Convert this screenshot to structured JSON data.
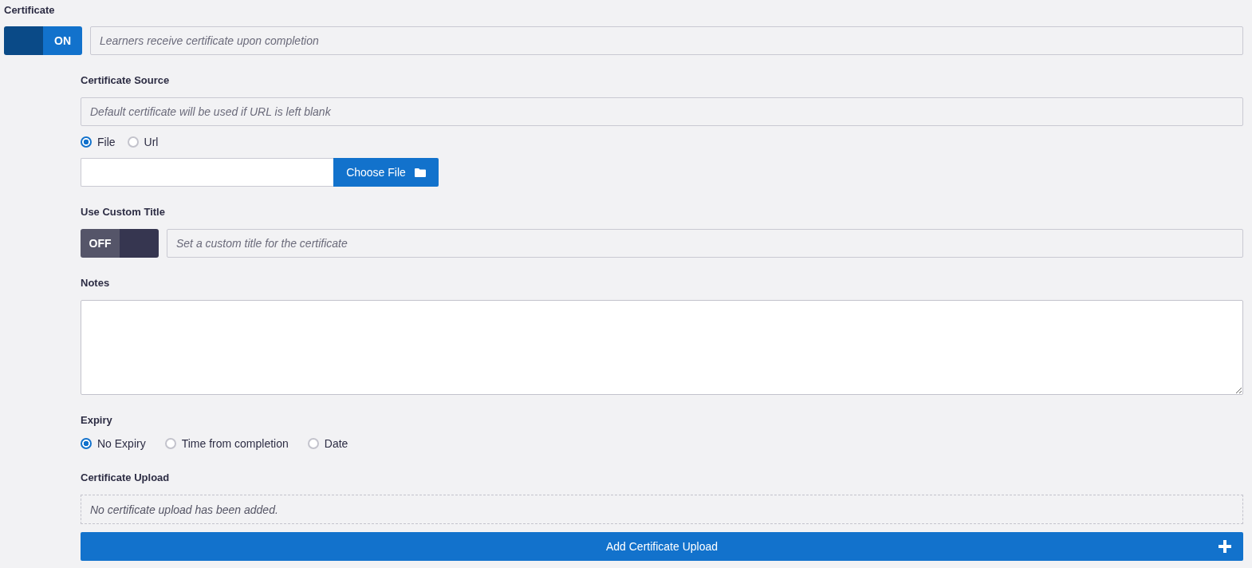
{
  "certificate": {
    "label": "Certificate",
    "toggle": {
      "on": true,
      "label": "ON"
    },
    "description": {
      "placeholder": "Learners receive certificate upon completion"
    }
  },
  "certificate_source": {
    "label": "Certificate Source",
    "description": {
      "placeholder": "Default certificate will be used if URL is left blank"
    },
    "options": [
      {
        "label": "File",
        "selected": true
      },
      {
        "label": "Url",
        "selected": false
      }
    ],
    "choose_file_button": "Choose File"
  },
  "custom_title": {
    "label": "Use Custom Title",
    "toggle": {
      "on": false,
      "label": "OFF"
    },
    "title_field": {
      "placeholder": "Set a custom title for the certificate"
    }
  },
  "notes": {
    "label": "Notes"
  },
  "expiry": {
    "label": "Expiry",
    "options": [
      {
        "label": "No Expiry",
        "selected": true
      },
      {
        "label": "Time from completion",
        "selected": false
      },
      {
        "label": "Date",
        "selected": false
      }
    ]
  },
  "certificate_upload": {
    "label": "Certificate Upload",
    "empty_message": "No certificate upload has been added.",
    "add_button": "Add Certificate Upload"
  }
}
